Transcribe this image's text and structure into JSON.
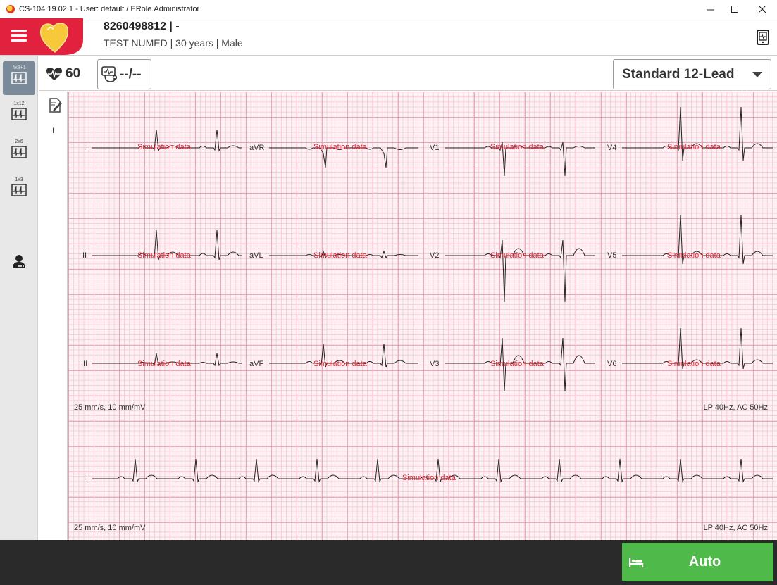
{
  "window": {
    "title": "CS-104 19.02.1 - User: default / ERole.Administrator",
    "icon": "app-logo-icon"
  },
  "header": {
    "menu_icon": "hamburger-menu-icon",
    "logo_icon": "heart-logo-icon",
    "brand_color": "#e2213f",
    "patient_id": "8260498812 | -",
    "patient_info": "TEST NUMED | 30 years | Male",
    "device_icon": "tablet-device-icon"
  },
  "sidebar": {
    "items": [
      {
        "label": "4x3+1",
        "icon": "ecg-layout-icon",
        "active": true
      },
      {
        "label": "1x12",
        "icon": "ecg-layout-icon",
        "active": false
      },
      {
        "label": "2x6",
        "icon": "ecg-layout-icon",
        "active": false
      },
      {
        "label": "1x3",
        "icon": "ecg-layout-icon",
        "active": false
      }
    ],
    "user_icon": "user-icon"
  },
  "toolbar": {
    "heart_rate": "60",
    "heart_rate_icon": "heart-pulse-icon",
    "bp_value": "--/--",
    "bp_icon": "blood-pressure-icon",
    "lead_mode": "Standard 12-Lead"
  },
  "tools": {
    "edit_icon": "edit-report-icon",
    "rhythm_marker": "I"
  },
  "ecg": {
    "rows": [
      [
        "I",
        "aVR",
        "V1",
        "V4"
      ],
      [
        "II",
        "aVL",
        "V2",
        "V5"
      ],
      [
        "III",
        "aVF",
        "V3",
        "V6"
      ]
    ],
    "rhythm_lead": "I",
    "watermark": "Simulation data",
    "speed_info": "25 mm/s, 10 mm/mV",
    "filter_info": "LP 40Hz, AC 50Hz",
    "grid_color": "#e296aa",
    "trace_color": "#222222",
    "watermark_color": "#e02a3a"
  },
  "footer": {
    "auto_label": "Auto",
    "auto_icon": "bed-icon",
    "auto_color": "#4fb94a"
  }
}
